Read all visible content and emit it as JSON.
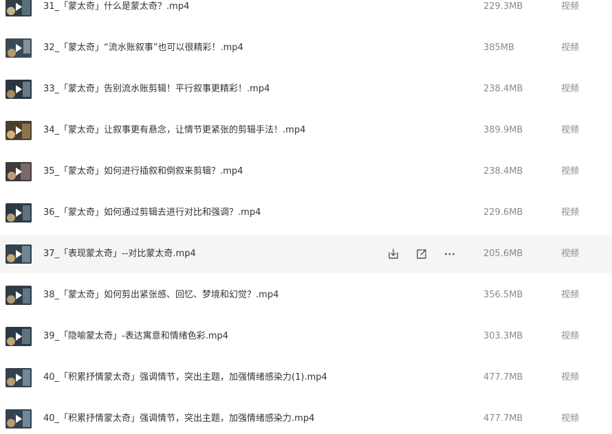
{
  "files": [
    {
      "name": "31_「蒙太奇」什么是蒙太奇？.mp4",
      "size": "229.3MB",
      "type": "视频"
    },
    {
      "name": "32_「蒙太奇」“流水账叙事”也可以很精彩！.mp4",
      "size": "385MB",
      "type": "视频"
    },
    {
      "name": "33_「蒙太奇」告别流水账剪辑！平行叙事更精彩！.mp4",
      "size": "238.4MB",
      "type": "视频"
    },
    {
      "name": "34_「蒙太奇」让叙事更有悬念，让情节更紧张的剪辑手法！.mp4",
      "size": "389.9MB",
      "type": "视频"
    },
    {
      "name": "35_「蒙太奇」如何进行插叙和倒叙来剪辑？.mp4",
      "size": "238.4MB",
      "type": "视频"
    },
    {
      "name": "36_「蒙太奇」如何通过剪辑去进行对比和强调？.mp4",
      "size": "229.6MB",
      "type": "视频"
    },
    {
      "name": "37_「表现蒙太奇」--对比蒙太奇.mp4",
      "size": "205.6MB",
      "type": "视频"
    },
    {
      "name": "38_「蒙太奇」如何剪出紧张感、回忆、梦境和幻觉？.mp4",
      "size": "356.5MB",
      "type": "视频"
    },
    {
      "name": "39_「隐喻蒙太奇」-表达寓意和情绪色彩.mp4",
      "size": "303.3MB",
      "type": "视频"
    },
    {
      "name": "40_「积累抒情蒙太奇」强调情节，突出主题，加强情绪感染力(1).mp4",
      "size": "477.7MB",
      "type": "视频"
    },
    {
      "name": "40_「积累抒情蒙太奇」强调情节，突出主题，加强情绪感染力.mp4",
      "size": "477.7MB",
      "type": "视频"
    }
  ],
  "hovered_row": 6,
  "row_actions": [
    {
      "icon": "download-icon"
    },
    {
      "icon": "share-icon"
    },
    {
      "icon": "more-icon"
    }
  ],
  "colors": {
    "name_text": "#333333",
    "meta_text": "#8a8a8a",
    "hover_bg": "#f5f5f6"
  }
}
